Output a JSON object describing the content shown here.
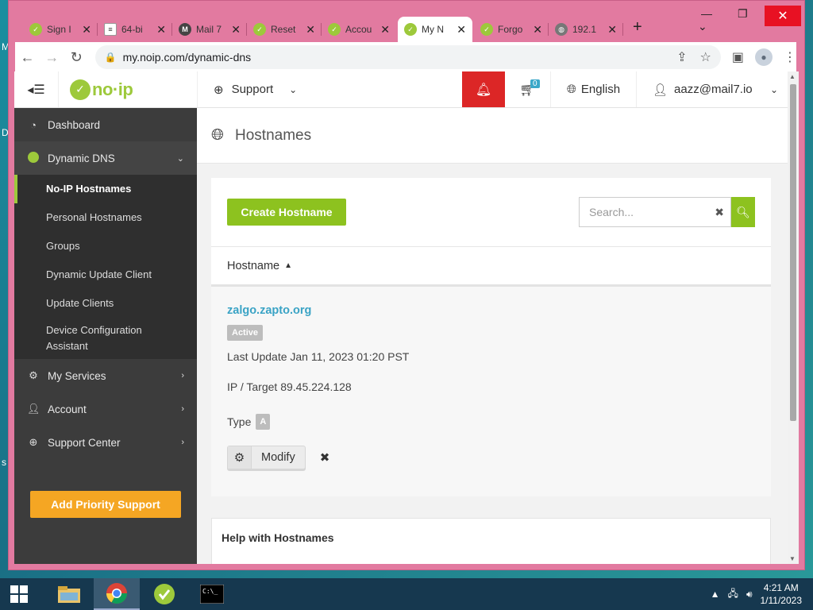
{
  "desktop": {
    "edge_letters": [
      "M",
      "D",
      "s"
    ]
  },
  "browser": {
    "tabs": [
      {
        "title": "Sign I",
        "icon": "noip-favicon"
      },
      {
        "title": "64-bi",
        "icon": "document-favicon"
      },
      {
        "title": "Mail 7",
        "icon": "mail-favicon"
      },
      {
        "title": "Reset",
        "icon": "noip-favicon"
      },
      {
        "title": "Accou",
        "icon": "noip-favicon"
      },
      {
        "title": "My N",
        "icon": "noip-favicon",
        "active": true
      },
      {
        "title": "Forgo",
        "icon": "noip-favicon"
      },
      {
        "title": "192.1",
        "icon": "globe-favicon"
      }
    ],
    "url": "my.noip.com/dynamic-dns"
  },
  "site": {
    "support_label": "Support",
    "cart_count": "0",
    "language": "English",
    "user_email": "aazz@mail7.io"
  },
  "sidebar": {
    "dashboard": "Dashboard",
    "dynamic_dns": "Dynamic DNS",
    "sub": [
      "No-IP Hostnames",
      "Personal Hostnames",
      "Groups",
      "Dynamic Update Client",
      "Update Clients",
      "Device Configuration Assistant"
    ],
    "my_services": "My Services",
    "account": "Account",
    "support_center": "Support Center",
    "priority_button": "Add Priority Support"
  },
  "main": {
    "title": "Hostnames",
    "create_button": "Create Hostname",
    "search_placeholder": "Search...",
    "column_header": "Hostname",
    "host": {
      "name": "zalgo.zapto.org",
      "status": "Active",
      "last_update": "Last Update Jan 11, 2023 01:20 PST",
      "ip_target": "IP / Target 89.45.224.128",
      "type_label": "Type",
      "type_value": "A",
      "modify_label": "Modify"
    },
    "help_title": "Help with Hostnames"
  },
  "taskbar": {
    "time": "4:21 AM",
    "date": "1/11/2023"
  },
  "colors": {
    "brand_green": "#8dc21f",
    "alert_red": "#dc2626",
    "priority_orange": "#f5a623",
    "link_blue": "#3aa3c5",
    "window_frame": "#e27aa0"
  }
}
